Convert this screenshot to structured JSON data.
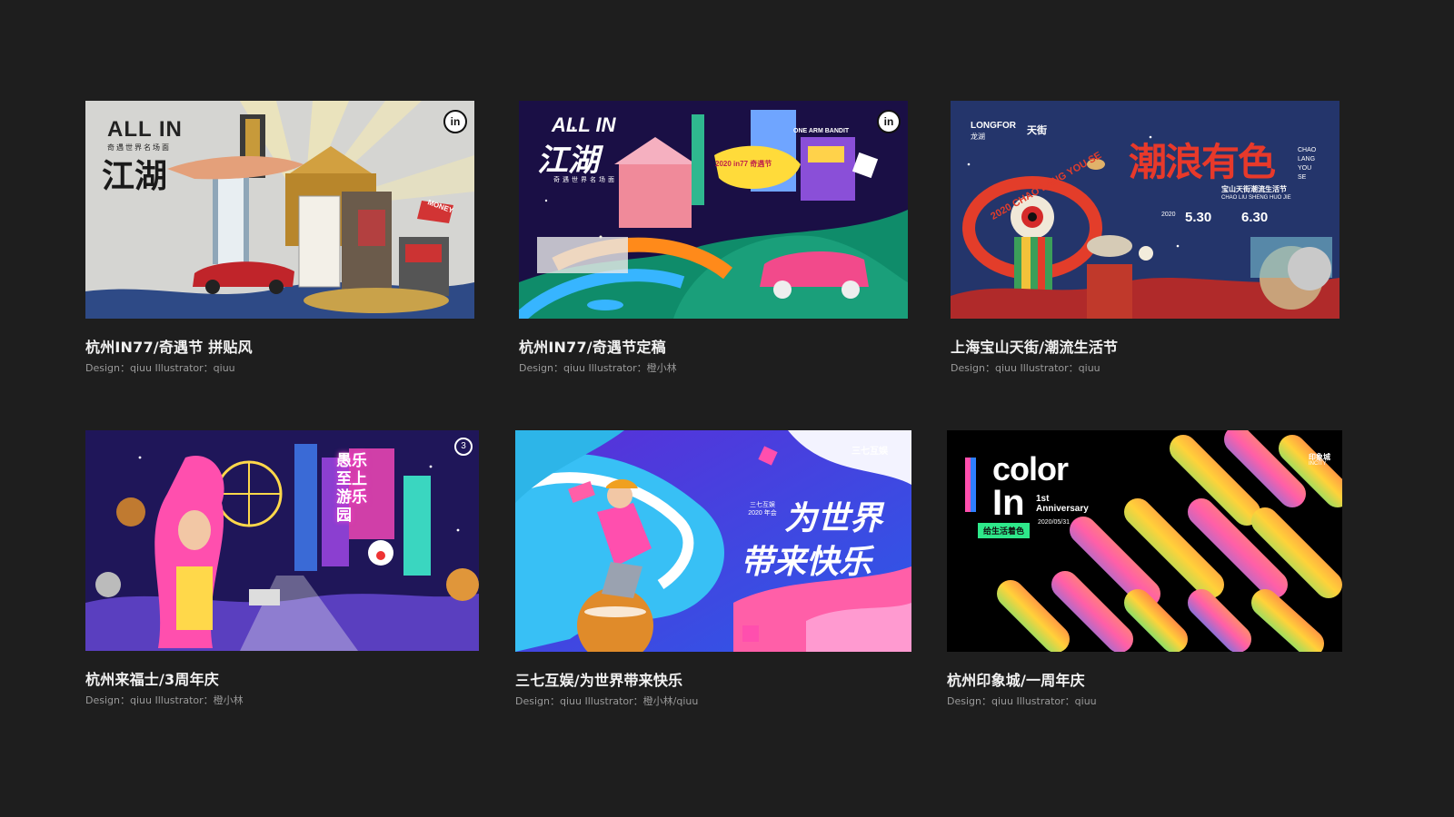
{
  "cards": [
    {
      "title": "杭州IN77/奇遇节 拼贴风",
      "credit": "Design：qiuu  Illustrator：qiuu",
      "art": {
        "headline": "ALL IN",
        "sub": "奇遇世界名场面",
        "cn": "江湖",
        "badge": "in",
        "money": "MONEY"
      }
    },
    {
      "title": "杭州IN77/奇遇节定稿",
      "credit": "Design：qiuu  Illustrator：橙小林",
      "art": {
        "headline": "ALL IN",
        "cn": "江湖",
        "sub": "奇遇世界名场面",
        "badge": "in",
        "sign": "2020 in77 奇遇节",
        "bandit": "ONE ARM BANDIT"
      }
    },
    {
      "title": "上海宝山天街/潮流生活节",
      "credit": "Design：qiuu  Illustrator：qiuu",
      "art": {
        "brand": "LONGFOR",
        "brand_cn": "龙湖",
        "brand2": "天街",
        "cn": "潮浪有色",
        "pinyin": "CHAO LANG YOU SE",
        "sub": "宝山天街潮流生活节",
        "sub_pinyin": "CHAO LIU SHENG HUO JIE",
        "year": "2020",
        "date_start": "5.30",
        "date_end": "6.30",
        "ring": "2020 CHAO LANG YOU SE"
      }
    },
    {
      "title": "杭州来福士/3周年庆",
      "credit": "Design：qiuu  Illustrator：橙小林",
      "art": {
        "cn": "愚乐至上 游乐园",
        "badge": "3"
      }
    },
    {
      "title": "三七互娱/为世界带来快乐",
      "credit": "Design：qiuu  Illustrator：橙小林/qiuu",
      "art": {
        "brand": "三七互娱",
        "small": "三七互娱 2020 年会",
        "line1": "为世界",
        "line2": "带来快乐"
      }
    },
    {
      "title": "杭州印象城/一周年庆",
      "credit": "Design：qiuu  Illustrator：qiuu",
      "art": {
        "big1": "color",
        "big2": "In",
        "anniv": "1st Anniversary",
        "date": "2020/05/31",
        "tag": "给生活着色",
        "brand": "印象城",
        "brand_en": "INCITY"
      }
    }
  ],
  "colors": {
    "background": "#1e1e1e",
    "title": "#f2f2f2",
    "credit": "#9a9a9a"
  }
}
